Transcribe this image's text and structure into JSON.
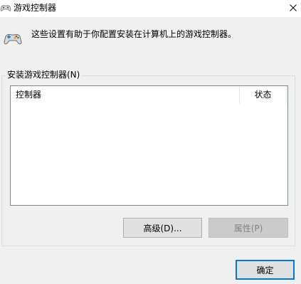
{
  "window": {
    "title": "游戏控制器",
    "title_icon": "gamepad-icon",
    "close_icon": "close-icon"
  },
  "header": {
    "icon": "gamepad-icon",
    "description": "这些设置有助于你配置安装在计算机上的游戏控制器。"
  },
  "installed_group": {
    "label": "安装游戏控制器(N)",
    "columns": [
      "控制器",
      "状态"
    ],
    "rows": []
  },
  "buttons": {
    "advanced": "高级(D)...",
    "properties": "属性(P)",
    "ok": "确定"
  },
  "colors": {
    "accent": "#0078d7",
    "window_bg": "#f0f0f0",
    "disabled_text": "#838383"
  }
}
